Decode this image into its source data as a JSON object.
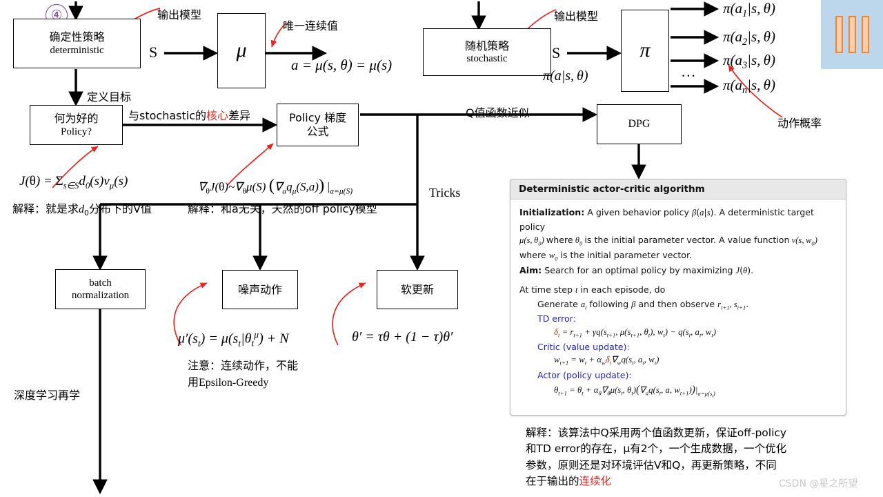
{
  "meta": {
    "watermark": "CSDN @星之所望",
    "step_number": "④"
  },
  "boxes": {
    "deterministic": {
      "line1": "确定性策略",
      "line2": "deterministic"
    },
    "mu": {
      "label": "μ"
    },
    "stochastic": {
      "line1": "随机策略",
      "line2": "stochastic"
    },
    "pi": {
      "label": "π"
    },
    "good_policy": {
      "line1": "何为好的",
      "line2": "Policy?"
    },
    "policy_gradient": {
      "line1": "Policy 梯度",
      "line2": "公式"
    },
    "dpg": {
      "label": "DPG"
    },
    "batch_norm": {
      "line1": "batch",
      "line2": "normalization"
    },
    "noise_action": {
      "label": "噪声动作"
    },
    "soft_update": {
      "label": "软更新"
    }
  },
  "labels": {
    "output_model_left": "输出模型",
    "output_model_right": "输出模型",
    "unique_continuous": "唯一连续值",
    "define_goal": "定义目标",
    "core_diff_pre": "与stochastic的",
    "core_diff_mid": "核心",
    "core_diff_post": "差异",
    "q_approx": "Q值函数近似",
    "action_prob": "动作概率",
    "tricks": "Tricks",
    "deep_learning": "深度学习再学",
    "s_left": "S",
    "s_right": "S",
    "pi_input": "π(a|s,θ)",
    "ellipsis": "..."
  },
  "outputs": [
    "π(a₁|s,θ)",
    "π(a₂|s,θ)",
    "π(a₃|s,θ)",
    "π(aₙ|s,θ)"
  ],
  "formulas": {
    "a_eq": "a = μ(s,θ) = μ(s)",
    "objective": "J(θ) = Σ_{s∈S} d₀(s) v_μ(s)",
    "objective_note": "解释：就是求d₀分布下的V值",
    "grad": "∇θJ(θ)~∇θμ(S) (∇a q_μ(S,a)) |a=μ(S)",
    "grad_note": "解释：和a无关，天然的off policy模型",
    "noise_eq": "μ′(s_t) = μ(s_t|θ_t^μ) + N",
    "noise_note1": "注意：连续动作，不能",
    "noise_note2": "用Epsilon-Greedy",
    "soft_eq": "θ′ = τθ + (1 − τ)θ′"
  },
  "algorithm": {
    "title": "Deterministic actor-critic algorithm",
    "init_label": "Initialization:",
    "init_text1": "A given behavior policy β(a|s). A deterministic target policy",
    "init_text2": "μ(s,θ₀) where θ₀ is the initial parameter vector. A value function v(s,w₀)",
    "init_text3": "where w₀ is the initial parameter vector.",
    "aim_label": "Aim:",
    "aim_text": "Search for an optimal policy by maximizing J(θ).",
    "loop_line": "At time step t in each episode, do",
    "generate_line": "Generate a_t following β and then observe r_{t+1}, s_{t+1}.",
    "td_label": "TD error:",
    "td_eq": "δ_t = r_{t+1} + γq(s_{t+1}, μ(s_{t+1}, θ_t), w_t) − q(s_t, a_t, w_t)",
    "critic_label": "Critic (value update):",
    "critic_eq": "w_{t+1} = w_t + α_w δ_t ∇_w q(s_t, a_t, w_t)",
    "actor_label": "Actor (policy update):",
    "actor_eq": "θ_{t+1} = θ_t + α_θ ∇_θ μ(s_t, θ_t)(∇_a q(s_t, a, w_{t+1}))|_{a=μ(s_t)}"
  },
  "explanation": {
    "line1": "解释：该算法中Q采用两个值函数更新，保证off-policy",
    "line2": "和TD error的存在，μ有2个，一个生成数据，一个优化",
    "line3": "参数，原则还是对环境评估V和Q，再更新策略，不同",
    "line4_pre": "在于输出的",
    "line4_red": "连续化"
  },
  "colors": {
    "arrow_black": "#000000",
    "arrow_red": "#e8251f",
    "accent_purple": "#7a3fa8",
    "deco_bg": "#bcd6ec",
    "deco_bar": "#ef8535",
    "algo_header": "#e8e8e8",
    "algo_blue": "#2323c8",
    "algo_brown": "#8a3b1b"
  }
}
